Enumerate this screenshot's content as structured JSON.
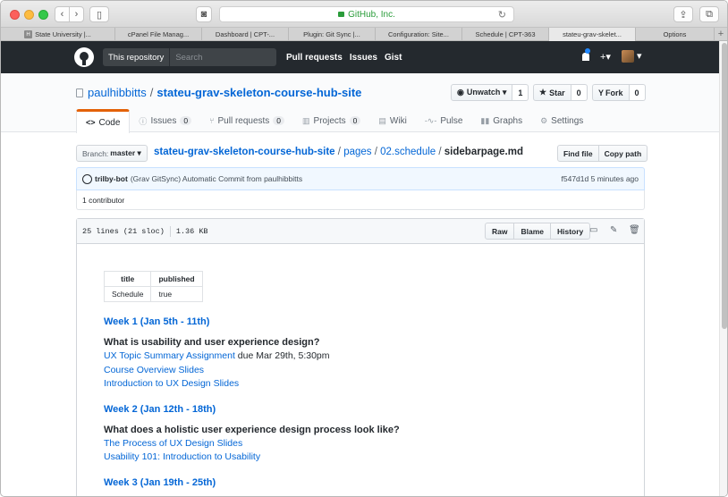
{
  "browser": {
    "address": "GitHub, Inc.",
    "tabs": [
      {
        "label": "State University |...",
        "favicon": "H"
      },
      {
        "label": "cPanel File Manag..."
      },
      {
        "label": "Dashboard | CPT-..."
      },
      {
        "label": "Plugin: Git Sync |..."
      },
      {
        "label": "Configuration: Site..."
      },
      {
        "label": "Schedule | CPT-363"
      },
      {
        "label": "stateu-grav-skelet...",
        "active": true
      },
      {
        "label": "Options"
      }
    ],
    "new_tab": "+"
  },
  "gh_header": {
    "search_scope": "This repository",
    "search_placeholder": "Search",
    "nav": [
      "Pull requests",
      "Issues",
      "Gist"
    ],
    "plus": "+▾",
    "avatar_caret": "▾"
  },
  "repo": {
    "owner": "paulhibbitts",
    "separator": "/",
    "name": "stateu-grav-skeleton-course-hub-site",
    "unwatch": {
      "label": "Unwatch ▾",
      "count": "1"
    },
    "star": {
      "label": "Star",
      "count": "0"
    },
    "fork": {
      "label": "Fork",
      "count": "0"
    },
    "tabs": [
      {
        "icon": "<>",
        "label": "Code",
        "count": ""
      },
      {
        "icon": "ⓘ",
        "label": "Issues",
        "count": "0"
      },
      {
        "icon": "⑂",
        "label": "Pull requests",
        "count": "0"
      },
      {
        "icon": "▥",
        "label": "Projects",
        "count": "0"
      },
      {
        "icon": "▤",
        "label": "Wiki",
        "count": ""
      },
      {
        "icon": "-∿-",
        "label": "Pulse",
        "count": ""
      },
      {
        "icon": "▮▮",
        "label": "Graphs",
        "count": ""
      },
      {
        "icon": "⚙",
        "label": "Settings",
        "count": ""
      }
    ]
  },
  "file_nav": {
    "branch_label": "Branch:",
    "branch": "master ▾",
    "path_root": "stateu-grav-skeleton-course-hub-site",
    "path_sep": "/",
    "path_1": "pages",
    "path_2": "02.schedule",
    "file": "sidebarpage.md",
    "find_file": "Find file",
    "copy_path": "Copy path"
  },
  "commit": {
    "author": "trilby-bot",
    "message": "(Grav GitSync) Automatic Commit from paulhibbitts",
    "sha_time": "f547d1d 5 minutes ago",
    "contributors": "1 contributor"
  },
  "file": {
    "lines": "25 lines (21 sloc)",
    "size": "1.36 KB",
    "raw": "Raw",
    "blame": "Blame",
    "history": "History",
    "frontmatter": {
      "headers": [
        "title",
        "published"
      ],
      "row": [
        "Schedule",
        "true"
      ]
    },
    "weeks": [
      {
        "title": "Week 1 (Jan 5th - 11th)",
        "question": "What is usability and user experience design?",
        "links": [
          {
            "text": "UX Topic Summary Assignment",
            "suffix": " due Mar 29th, 5:30pm"
          },
          {
            "text": "Course Overview Slides",
            "suffix": ""
          },
          {
            "text": "Introduction to UX Design Slides",
            "suffix": ""
          }
        ]
      },
      {
        "title": "Week 2 (Jan 12th - 18th)",
        "question": "What does a holistic user experience design process look like?",
        "links": [
          {
            "text": "The Process of UX Design Slides",
            "suffix": ""
          },
          {
            "text": "Usability 101: Introduction to Usability",
            "suffix": ""
          }
        ]
      },
      {
        "title": "Week 3 (Jan 19th - 25th)",
        "question": "",
        "links": []
      }
    ]
  }
}
